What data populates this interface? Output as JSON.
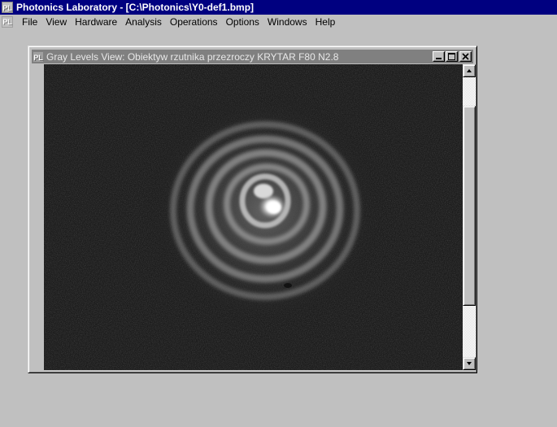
{
  "app": {
    "icon_label": "PL",
    "title": "Photonics Laboratory - [C:\\Photonics\\Y0-def1.bmp]"
  },
  "menu": {
    "items": [
      {
        "label": "File"
      },
      {
        "label": "View"
      },
      {
        "label": "Hardware"
      },
      {
        "label": "Analysis"
      },
      {
        "label": "Operations"
      },
      {
        "label": "Options"
      },
      {
        "label": "Windows"
      },
      {
        "label": "Help"
      }
    ]
  },
  "child_window": {
    "icon_label": "PL",
    "title": "Gray Levels View: Obiektyw rzutnika przezroczy KRYTAR F80  N2.8",
    "buttons": {
      "minimize": "minimize-icon",
      "maximize": "maximize-icon",
      "close": "close-icon"
    },
    "image": {
      "description_icon": "interference-pattern-image",
      "background_color": "#1c1c1c",
      "ring_color": "#9a9a9a",
      "core_color": "#ffffff"
    },
    "scrollbar": {
      "position": 0.1
    }
  },
  "colors": {
    "app_title_bg": "#000080",
    "child_title_bg": "#808080",
    "face": "#c0c0c0"
  }
}
